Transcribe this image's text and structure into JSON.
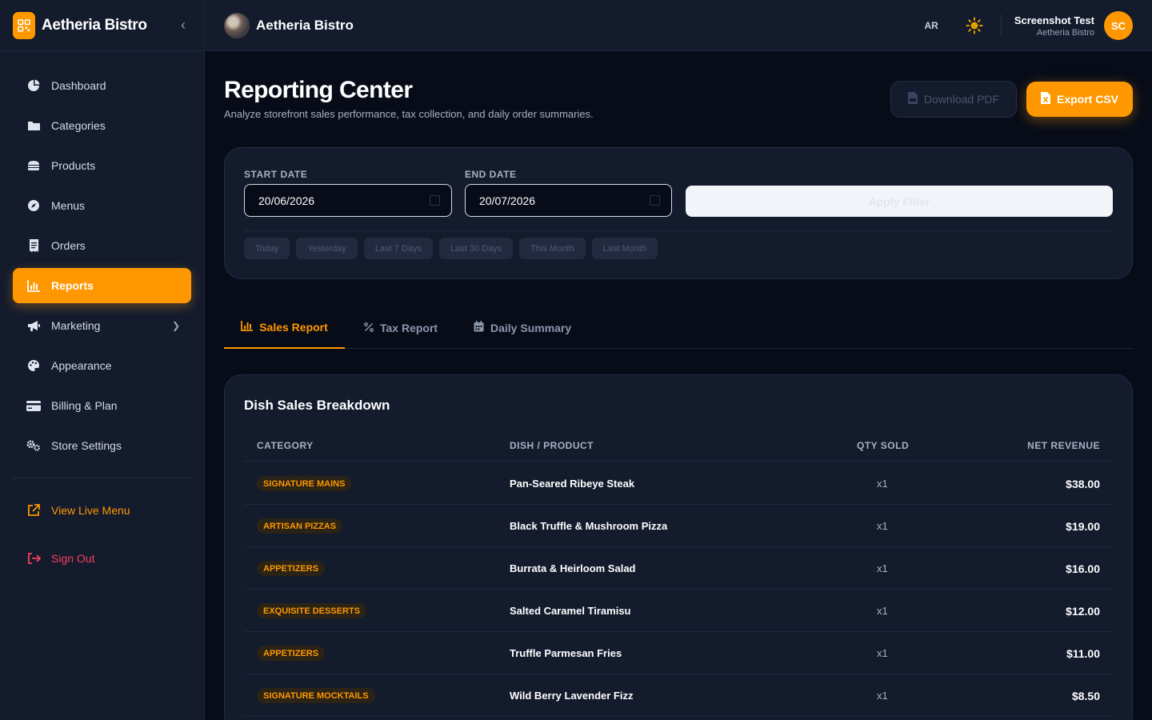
{
  "brand": {
    "name": "Aetheria Bistro"
  },
  "sidebar": {
    "items": [
      {
        "label": "Dashboard",
        "icon": "pie-chart-icon"
      },
      {
        "label": "Categories",
        "icon": "folder-icon"
      },
      {
        "label": "Products",
        "icon": "burger-icon"
      },
      {
        "label": "Menus",
        "icon": "compass-icon"
      },
      {
        "label": "Orders",
        "icon": "receipt-icon"
      },
      {
        "label": "Reports",
        "icon": "bar-chart-icon",
        "active": true
      },
      {
        "label": "Marketing",
        "icon": "megaphone-icon"
      },
      {
        "label": "Appearance",
        "icon": "palette-icon"
      },
      {
        "label": "Billing & Plan",
        "icon": "credit-card-icon"
      },
      {
        "label": "Store Settings",
        "icon": "gears-icon"
      }
    ],
    "view_live": "View Live Menu",
    "sign_out": "Sign Out"
  },
  "topbar": {
    "title": "Aetheria Bistro",
    "lang": "AR",
    "user_name": "Screenshot Test",
    "user_sub": "Aetheria Bistro",
    "user_initials": "SC"
  },
  "page": {
    "title": "Reporting Center",
    "subtitle": "Analyze storefront sales performance, tax collection, and daily order summaries.",
    "download_pdf": "Download PDF",
    "export_csv": "Export CSV"
  },
  "filter": {
    "start_label": "START DATE",
    "start_value": "20/06/2026",
    "end_label": "END DATE",
    "end_value": "20/07/2026",
    "apply": "Apply Filter",
    "quick": [
      "Today",
      "Yesterday",
      "Last 7 Days",
      "Last 30 Days",
      "This Month",
      "Last Month"
    ]
  },
  "tabs": [
    {
      "label": "Sales Report",
      "icon": "bar-chart-icon",
      "active": true
    },
    {
      "label": "Tax Report",
      "icon": "percent-icon"
    },
    {
      "label": "Daily Summary",
      "icon": "calendar-icon"
    }
  ],
  "table": {
    "title": "Dish Sales Breakdown",
    "columns": [
      "CATEGORY",
      "DISH / PRODUCT",
      "QTY SOLD",
      "NET REVENUE"
    ],
    "rows": [
      {
        "category": "SIGNATURE MAINS",
        "dish": "Pan-Seared Ribeye Steak",
        "qty": "x1",
        "revenue": "$38.00"
      },
      {
        "category": "ARTISAN PIZZAS",
        "dish": "Black Truffle & Mushroom Pizza",
        "qty": "x1",
        "revenue": "$19.00"
      },
      {
        "category": "APPETIZERS",
        "dish": "Burrata & Heirloom Salad",
        "qty": "x1",
        "revenue": "$16.00"
      },
      {
        "category": "EXQUISITE DESSERTS",
        "dish": "Salted Caramel Tiramisu",
        "qty": "x1",
        "revenue": "$12.00"
      },
      {
        "category": "APPETIZERS",
        "dish": "Truffle Parmesan Fries",
        "qty": "x1",
        "revenue": "$11.00"
      },
      {
        "category": "SIGNATURE MOCKTAILS",
        "dish": "Wild Berry Lavender Fizz",
        "qty": "x1",
        "revenue": "$8.50"
      }
    ]
  },
  "colors": {
    "accent": "#ff9800",
    "danger": "#f43f5e",
    "bg": "#070c18",
    "panel": "#141b2d"
  }
}
